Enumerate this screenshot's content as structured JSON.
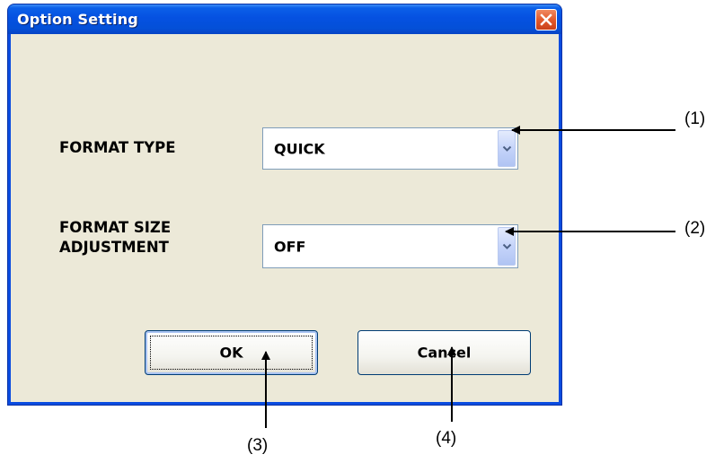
{
  "window": {
    "title": "Option Setting"
  },
  "fields": {
    "format_type": {
      "label": "FORMAT TYPE",
      "value": "QUICK"
    },
    "format_size_adjustment": {
      "label_line1": "FORMAT SIZE",
      "label_line2": "ADJUSTMENT",
      "value": "OFF"
    }
  },
  "buttons": {
    "ok": "OK",
    "cancel": "Cancel"
  },
  "callouts": {
    "c1": "(1)",
    "c2": "(2)",
    "c3": "(3)",
    "c4": "(4)"
  },
  "icons": {
    "close": "close-icon",
    "dropdown": "chevron-down-icon"
  },
  "colors": {
    "titlebar": "#0551e1",
    "client": "#ece9d8",
    "close": "#e25a2c"
  }
}
